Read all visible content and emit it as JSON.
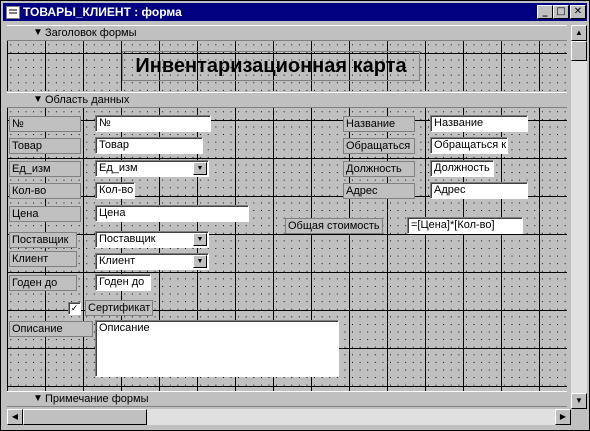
{
  "window": {
    "title": "ТОВАРЫ_КЛИЕНТ : форма"
  },
  "title_buttons": {
    "minimize": "_",
    "maximize": "□",
    "close": "✕"
  },
  "sections": {
    "header": "Заголовок формы",
    "detail": "Область данных",
    "footer": "Примечание формы"
  },
  "form_title": "Инвентаризационная карта",
  "fields": {
    "num": {
      "label": "№",
      "value": "№"
    },
    "tovar": {
      "label": "Товар",
      "value": "Товар"
    },
    "ed_izm": {
      "label": "Ед_изм",
      "value": "Ед_изм"
    },
    "kol_vo": {
      "label": "Кол-во",
      "value": "Кол-во"
    },
    "cena": {
      "label": "Цена",
      "value": "Цена"
    },
    "postavshik": {
      "label": "Поставщик",
      "value": "Поставщик"
    },
    "klient": {
      "label": "Клиент",
      "value": "Клиент"
    },
    "goden_do": {
      "label": "Годен до",
      "value": "Годен до"
    },
    "sertifikat": {
      "label": "Сертификат",
      "checked": "✓"
    },
    "opisanie": {
      "label": "Описание",
      "value": "Описание"
    },
    "nazvanie": {
      "label": "Название",
      "value": "Название"
    },
    "obrashatsya": {
      "label": "Обращаться к",
      "value": "Обращаться к"
    },
    "dolzhnost": {
      "label": "Должность",
      "value": "Должность"
    },
    "adres": {
      "label": "Адрес",
      "value": "Адрес"
    },
    "total": {
      "label": "Общая стоимость",
      "value": "=[Цена]*[Кол-во]"
    }
  },
  "icons": {
    "section_arrow": "▼",
    "combo_arrow": "▼",
    "scroll_up": "▲",
    "scroll_down": "▼",
    "scroll_left": "◀",
    "scroll_right": "▶"
  }
}
